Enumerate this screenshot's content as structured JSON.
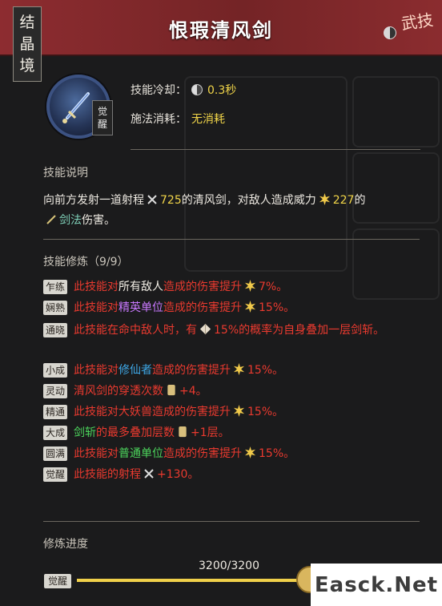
{
  "header": {
    "vertical_tag": [
      "结",
      "晶",
      "境"
    ],
    "title": "恨瑕清风剑",
    "brand_text": "武技"
  },
  "skill": {
    "icon": "sword-skill-icon",
    "badge": [
      "觉",
      "醒"
    ],
    "cooldown_label": "技能冷却：",
    "cooldown_value": "0.3秒",
    "cost_label": "施法消耗：",
    "cost_value": "无消耗"
  },
  "description": {
    "title": "技能说明",
    "part1": "向前方发射一道射程",
    "range": "725",
    "part2": "的清风剑，对敌人造成威力",
    "power": "227",
    "part3": "的",
    "damage_type": "剑法",
    "part4": "伤害。"
  },
  "upgrades": {
    "title": "技能修炼（9/9）",
    "items": [
      {
        "badge": "乍练",
        "segments": [
          {
            "t": "此技能对",
            "c": "red"
          },
          {
            "t": "所有敌人",
            "c": "white"
          },
          {
            "t": "造成的伤害提升",
            "c": "red"
          },
          {
            "icon": "burst-icon"
          },
          {
            "t": "7%。",
            "c": "red"
          }
        ]
      },
      {
        "badge": "娴熟",
        "segments": [
          {
            "t": "此技能对",
            "c": "red"
          },
          {
            "t": "精英单位",
            "c": "purple"
          },
          {
            "t": "造成的伤害提升",
            "c": "red"
          },
          {
            "icon": "burst-icon"
          },
          {
            "t": "15%。",
            "c": "red"
          }
        ]
      },
      {
        "badge": "通晓",
        "segments": [
          {
            "t": "此技能在命中敌人时，有",
            "c": "red"
          },
          {
            "icon": "gem-icon"
          },
          {
            "t": "15%的概率为自身叠加一层剑斩。",
            "c": "red"
          }
        ]
      },
      {
        "badge": "小成",
        "segments": [
          {
            "t": "此技能对",
            "c": "red"
          },
          {
            "t": "修仙者",
            "c": "blue"
          },
          {
            "t": "造成的伤害提升",
            "c": "red"
          },
          {
            "icon": "burst-icon"
          },
          {
            "t": "15%。",
            "c": "red"
          }
        ]
      },
      {
        "badge": "灵动",
        "segments": [
          {
            "t": "清风剑的穿透次数",
            "c": "red"
          },
          {
            "icon": "scroll-icon"
          },
          {
            "t": "+4。",
            "c": "red"
          }
        ]
      },
      {
        "badge": "精通",
        "segments": [
          {
            "t": "此技能对大妖兽造成的伤害提升",
            "c": "red"
          },
          {
            "icon": "burst-icon"
          },
          {
            "t": "15%。",
            "c": "red"
          }
        ]
      },
      {
        "badge": "大成",
        "segments": [
          {
            "t": "剑斩",
            "c": "green"
          },
          {
            "t": "的最多叠加层数",
            "c": "red"
          },
          {
            "icon": "scroll-icon"
          },
          {
            "t": "+1层。",
            "c": "red"
          }
        ]
      },
      {
        "badge": "圆满",
        "segments": [
          {
            "t": "此技能对",
            "c": "red"
          },
          {
            "t": "普通单位",
            "c": "green"
          },
          {
            "t": "造成的伤害提升",
            "c": "red"
          },
          {
            "icon": "burst-icon"
          },
          {
            "t": "15%。",
            "c": "red"
          }
        ]
      },
      {
        "badge": "觉醒",
        "segments": [
          {
            "t": "此技能的射程",
            "c": "red"
          },
          {
            "icon": "range-icon"
          },
          {
            "t": "+130。",
            "c": "red"
          }
        ]
      }
    ]
  },
  "progress": {
    "title": "修炼进度",
    "text": "3200/3200",
    "badge": "觉醒",
    "fraction": 1.0
  },
  "watermark": "Easck.Net",
  "colors": {
    "header": "#7a2729",
    "value_yellow": "#f1d549",
    "upgrade_red": "#ea3a2f",
    "purple": "#c979ff",
    "blue": "#3ea7e6",
    "green": "#4cd45c",
    "teal": "#7fd0b8"
  }
}
